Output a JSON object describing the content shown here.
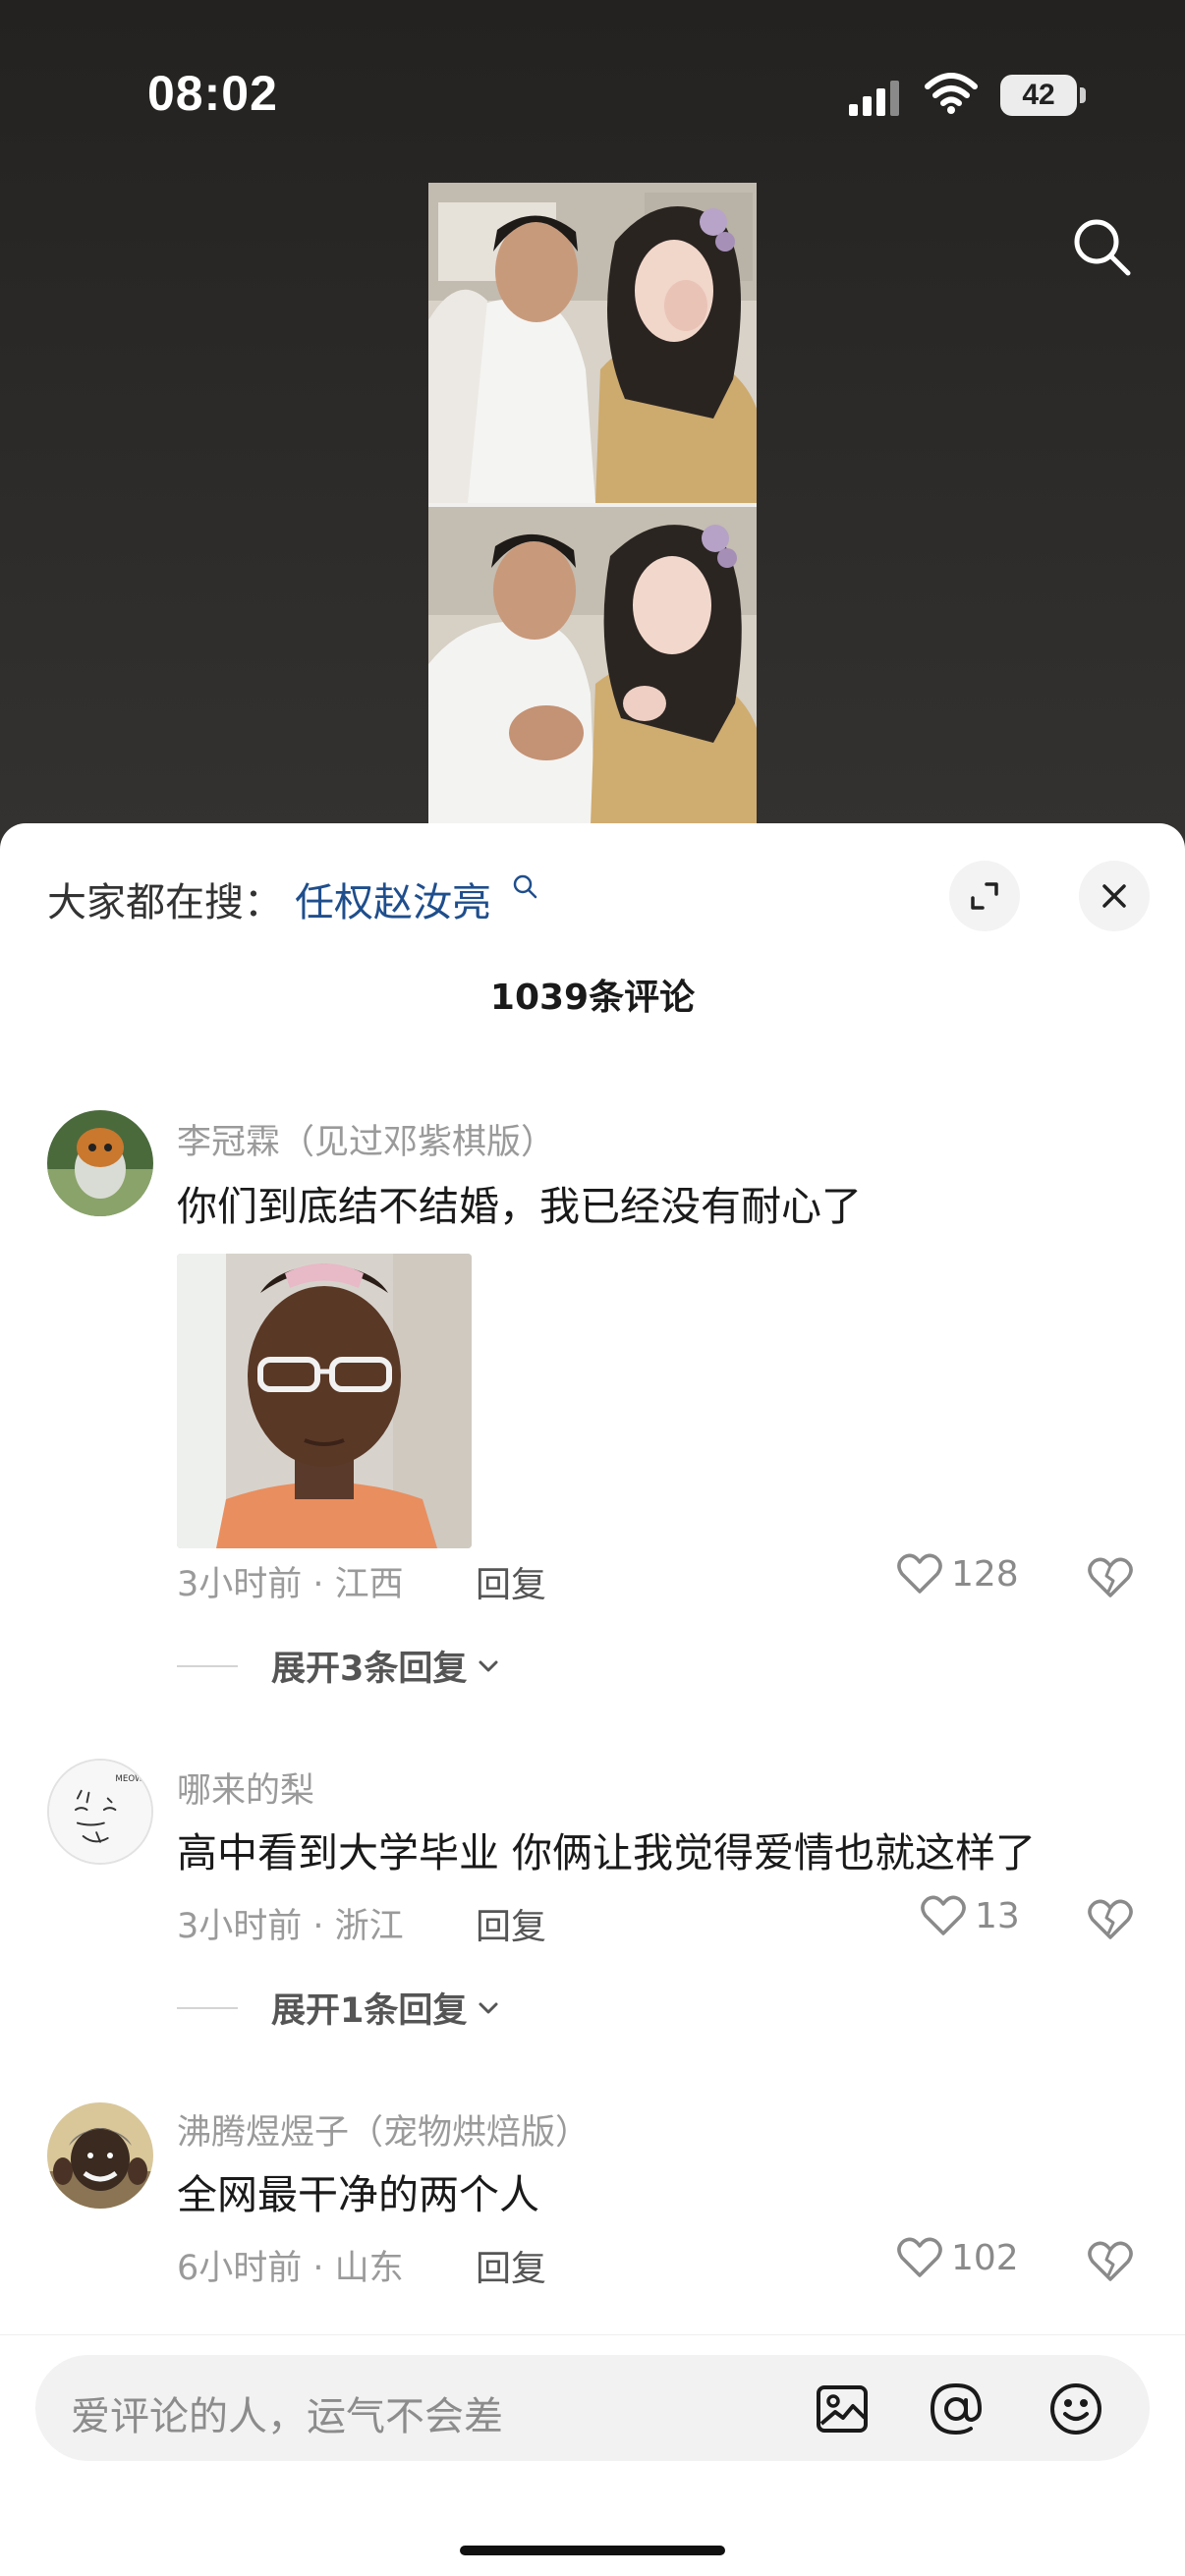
{
  "status_bar": {
    "time": "08:02",
    "battery": "42"
  },
  "search_bar": {
    "prefix": "大家都在搜：",
    "keyword": "任权赵汝亮"
  },
  "comments_header": {
    "count_label": "1039条评论"
  },
  "comments": [
    {
      "author": "李冠霖（见过邓紫棋版）",
      "text": "你们到底结不结婚，我已经没有耐心了",
      "meta": "3小时前 · 江西",
      "reply_label": "回复",
      "likes": "128",
      "expand_label": "展开3条回复"
    },
    {
      "author": "哪来的梨",
      "text": "高中看到大学毕业 你俩让我觉得爱情也就这样了",
      "meta": "3小时前 · 浙江",
      "reply_label": "回复",
      "likes": "13",
      "expand_label": "展开1条回复"
    },
    {
      "author": "沸腾煜煜子（宠物烘焙版）",
      "text": "全网最干净的两个人",
      "meta": "6小时前 · 山东",
      "reply_label": "回复",
      "likes": "102"
    }
  ],
  "input": {
    "placeholder": "爱评论的人，运气不会差"
  },
  "icons": {
    "status": [
      "signal-icon",
      "wifi-icon",
      "battery-icon"
    ],
    "header": [
      "search-icon",
      "expand-icon",
      "close-icon"
    ],
    "comment_actions": [
      "heart-icon",
      "broken-heart-icon",
      "chevron-down-icon"
    ],
    "input_actions": [
      "image-icon",
      "at-icon",
      "emoji-icon"
    ]
  },
  "colors": {
    "keyword": "#1f4e8c",
    "secondary_text": "#9a9a9a",
    "background_top": "#242220"
  }
}
